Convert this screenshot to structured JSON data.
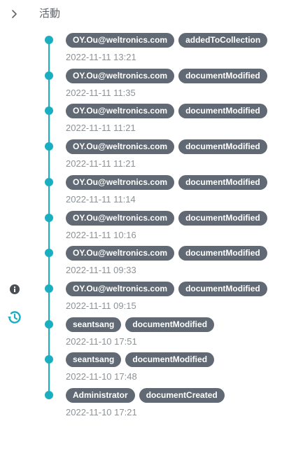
{
  "header": {
    "title": "活動",
    "collapse_icon": "chevron-right-icon"
  },
  "side_icons": [
    "info-icon",
    "history-icon"
  ],
  "colors": {
    "accent": "#1aafc0",
    "chip_background": "#616a74",
    "chip_text": "#ffffff",
    "timestamp_text": "#8c9297",
    "title_text": "#5f6368"
  },
  "activities": [
    {
      "user": "OY.Ou@weltronics.com",
      "action": "addedToCollection",
      "time": "2022-11-11 13:21"
    },
    {
      "user": "OY.Ou@weltronics.com",
      "action": "documentModified",
      "time": "2022-11-11 11:35"
    },
    {
      "user": "OY.Ou@weltronics.com",
      "action": "documentModified",
      "time": "2022-11-11 11:21"
    },
    {
      "user": "OY.Ou@weltronics.com",
      "action": "documentModified",
      "time": "2022-11-11 11:21"
    },
    {
      "user": "OY.Ou@weltronics.com",
      "action": "documentModified",
      "time": "2022-11-11 11:14"
    },
    {
      "user": "OY.Ou@weltronics.com",
      "action": "documentModified",
      "time": "2022-11-11 10:16"
    },
    {
      "user": "OY.Ou@weltronics.com",
      "action": "documentModified",
      "time": "2022-11-11 09:33"
    },
    {
      "user": "OY.Ou@weltronics.com",
      "action": "documentModified",
      "time": "2022-11-11 09:15"
    },
    {
      "user": "seantsang",
      "action": "documentModified",
      "time": "2022-11-10 17:51"
    },
    {
      "user": "seantsang",
      "action": "documentModified",
      "time": "2022-11-10 17:48"
    },
    {
      "user": "Administrator",
      "action": "documentCreated",
      "time": "2022-11-10 17:21"
    }
  ]
}
